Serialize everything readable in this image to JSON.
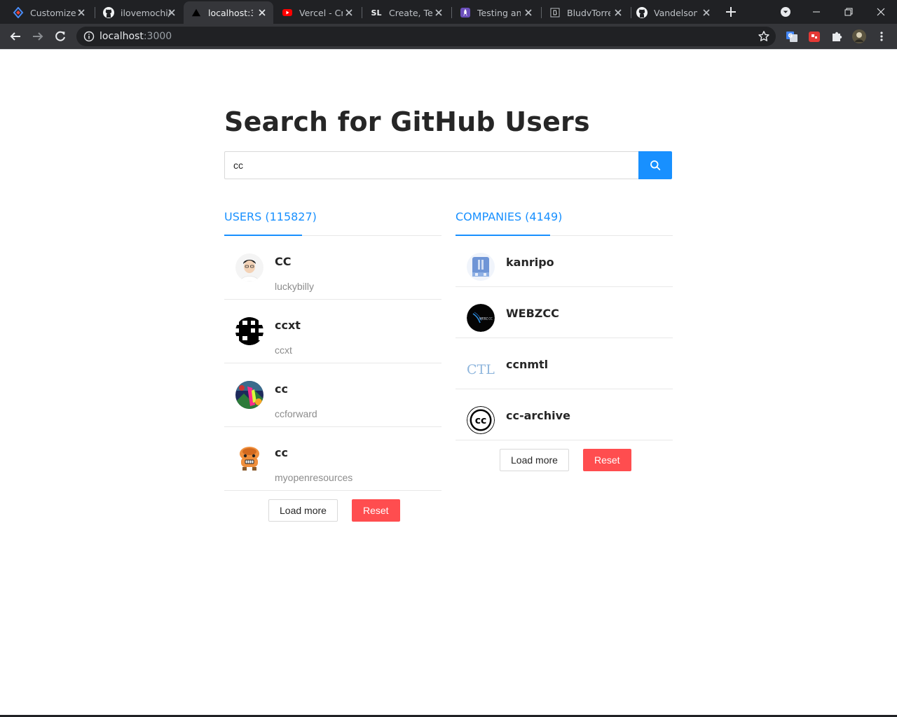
{
  "browser": {
    "tabs": [
      {
        "title": "Customize T",
        "icon": "kite-icon"
      },
      {
        "title": "ilovemochi/",
        "icon": "github-icon"
      },
      {
        "title": "localhost:30",
        "icon": "vercel-triangle-icon",
        "active": true
      },
      {
        "title": "Vercel - Cre",
        "icon": "youtube-icon"
      },
      {
        "title": "Create, Test",
        "icon": "sl-icon"
      },
      {
        "title": "Testing and",
        "icon": "rocket-icon"
      },
      {
        "title": "BludvTorren",
        "icon": "bludv-icon"
      },
      {
        "title": "Vandelson7",
        "icon": "github-icon"
      }
    ],
    "url_host": "localhost",
    "url_port": ":3000"
  },
  "page": {
    "title": "Search for GitHub Users",
    "search": {
      "value": "cc",
      "icon": "search-icon",
      "color": "#1890ff"
    }
  },
  "users": {
    "tab_label": "USERS (115827)",
    "items": [
      {
        "name": "CC",
        "login": "luckybilly"
      },
      {
        "name": "ccxt",
        "login": "ccxt"
      },
      {
        "name": "cc",
        "login": "ccforward"
      },
      {
        "name": "cc",
        "login": "myopenresources"
      }
    ],
    "load_more": "Load more",
    "reset": "Reset"
  },
  "companies": {
    "tab_label": "COMPANIES (4149)",
    "items": [
      {
        "name": "kanripo",
        "login": ""
      },
      {
        "name": "WEBZCC",
        "login": ""
      },
      {
        "name": "ccnmtl",
        "login": ""
      },
      {
        "name": "cc-archive",
        "login": ""
      }
    ],
    "load_more": "Load more",
    "reset": "Reset"
  },
  "logos": {
    "webzcc": "WEBZ.CC",
    "ctl": "CTL",
    "cc": "cc"
  },
  "colors": {
    "primary": "#1890ff",
    "danger": "#ff4d4f",
    "heading": "#262626",
    "secondary_text": "#8c8c8c"
  }
}
